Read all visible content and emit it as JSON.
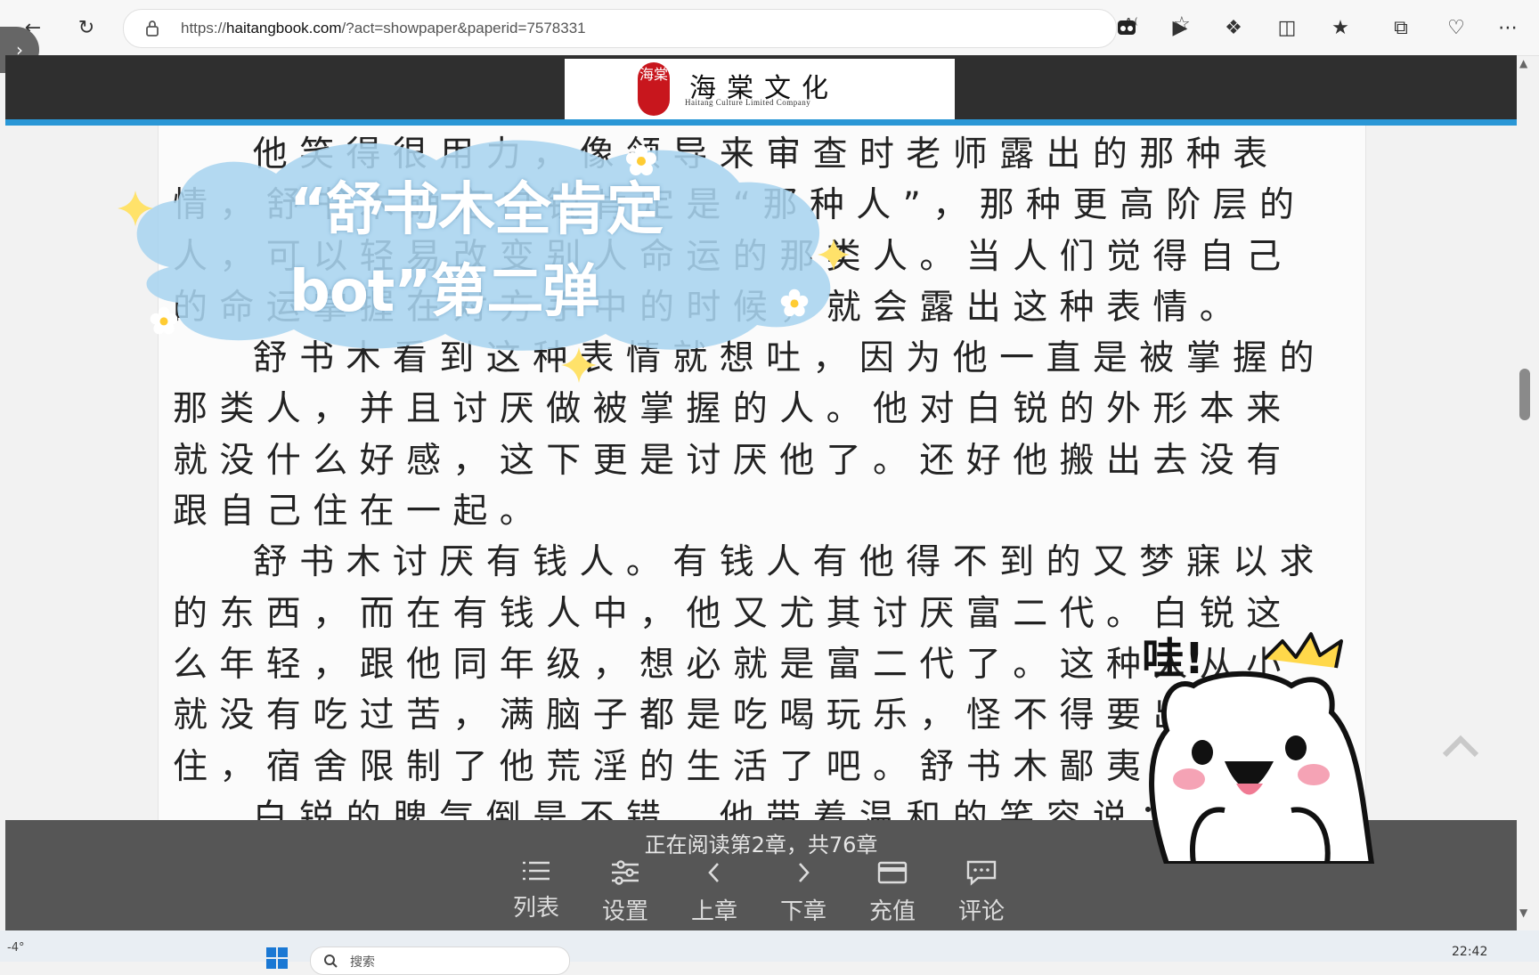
{
  "browser": {
    "url_prefix": "https://",
    "url_host": "haitangbook.com",
    "url_path": "/?act=showpaper&paperid=7578331"
  },
  "site": {
    "logo_seal": "海棠",
    "logo_title": "海棠文化",
    "logo_subtitle": "Haitang Culture Limited Company"
  },
  "chapter_text": [
    "他笑得很用力，像领导来审查时老师露出的那种表情，舒书木确定白锐肯定是“那种人”，那种更高阶层的人，可以轻易改变别人命运的那类人。当人们觉得自己的命运掌握在对方手中的时候，就会露出这种表情。",
    "舒书木看到这种表情就想吐，因为他一直是被掌握的那类人，并且讨厌做被掌握的人。他对白锐的外形本来就没什么好感，这下更是讨厌他了。还好他搬出去没有跟自己住在一起。",
    "舒书木讨厌有钱人。有钱人有他得不到的又梦寐以求的东西，而在有钱人中，他又尤其讨厌富二代。白锐这么年轻，跟他同年级，想必就是富二代了。这种人从小就没有吃过苦，满脑子都是吃喝玩乐，怪不得要出去住，宿舍限制了他荒淫的生活了吧。舒书木鄙夷地想。",
    "白锐的脾气倒是不错，他带着温和的笑容说："
  ],
  "reader_bar": {
    "progress_text": "正在阅读第2章，共76章",
    "buttons": [
      {
        "label": "列表",
        "icon": "list-icon"
      },
      {
        "label": "设置",
        "icon": "settings-sliders-icon"
      },
      {
        "label": "上章",
        "icon": "chevron-left-icon"
      },
      {
        "label": "下章",
        "icon": "chevron-right-icon"
      },
      {
        "label": "充值",
        "icon": "card-icon"
      },
      {
        "label": "评论",
        "icon": "comment-icon"
      }
    ]
  },
  "overlay": {
    "title_line1": "“舒书木全肯定",
    "title_line2": "bot”第二弹",
    "exclaim": "哇!"
  },
  "taskbar": {
    "weather": "-4°",
    "search_placeholder": "搜索",
    "time": "22:42"
  },
  "colors": {
    "header_bg": "#2f2f2f",
    "header_accent": "#2a97d6",
    "seal_red": "#c8161d",
    "reader_bar_bg": "#565656",
    "cloud_blue": "#a9d4ef"
  }
}
